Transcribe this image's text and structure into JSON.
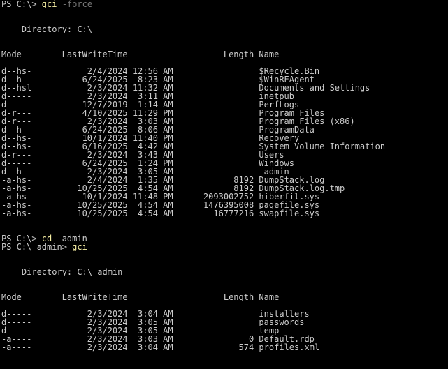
{
  "session1": {
    "prompt": "PS C:\\> ",
    "command": "gci",
    "param": " -force",
    "directory_label": "    Directory: C:\\",
    "headers": {
      "mode": "Mode",
      "lastwrite": "LastWriteTime",
      "length": "Length",
      "name": "Name"
    },
    "underlines": {
      "mode": "----",
      "lastwrite": "-------------",
      "length": "------",
      "name": "----"
    },
    "rows": [
      {
        "mode": "d--hs-",
        "date": "2/4/2024",
        "time": "12:56 AM",
        "length": "",
        "name": "$Recycle.Bin"
      },
      {
        "mode": "d--h--",
        "date": "6/24/2025",
        "time": "8:23 AM",
        "length": "",
        "name": "$WinREAgent"
      },
      {
        "mode": "d--hsl",
        "date": "2/3/2024",
        "time": "11:32 AM",
        "length": "",
        "name": "Documents and Settings"
      },
      {
        "mode": "d-----",
        "date": "2/3/2024",
        "time": "3:11 AM",
        "length": "",
        "name": "inetpub"
      },
      {
        "mode": "d-----",
        "date": "12/7/2019",
        "time": "1:14 AM",
        "length": "",
        "name": "PerfLogs"
      },
      {
        "mode": "d-r---",
        "date": "4/10/2025",
        "time": "11:29 PM",
        "length": "",
        "name": "Program Files"
      },
      {
        "mode": "d-r---",
        "date": "2/3/2024",
        "time": "3:03 AM",
        "length": "",
        "name": "Program Files (x86)"
      },
      {
        "mode": "d--h--",
        "date": "6/24/2025",
        "time": "8:06 AM",
        "length": "",
        "name": "ProgramData"
      },
      {
        "mode": "d--hs-",
        "date": "10/1/2024",
        "time": "11:40 PM",
        "length": "",
        "name": "Recovery"
      },
      {
        "mode": "d--hs-",
        "date": "6/16/2025",
        "time": "4:42 AM",
        "length": "",
        "name": "System Volume Information"
      },
      {
        "mode": "d-r---",
        "date": "2/3/2024",
        "time": "3:43 AM",
        "length": "",
        "name": "Users"
      },
      {
        "mode": "d-----",
        "date": "6/24/2025",
        "time": "1:24 PM",
        "length": "",
        "name": "Windows"
      },
      {
        "mode": "d--h--",
        "date": "2/3/2024",
        "time": "3:05 AM",
        "length": "",
        "name": "_admin"
      },
      {
        "mode": "-a-hs-",
        "date": "2/4/2024",
        "time": "1:35 AM",
        "length": "8192",
        "name": "DumpStack.log"
      },
      {
        "mode": "-a-hs-",
        "date": "10/25/2025",
        "time": "4:54 AM",
        "length": "8192",
        "name": "DumpStack.log.tmp"
      },
      {
        "mode": "-a-hs-",
        "date": "10/1/2024",
        "time": "11:48 PM",
        "length": "2093002752",
        "name": "hiberfil.sys"
      },
      {
        "mode": "-a-hs-",
        "date": "10/25/2025",
        "time": "4:54 AM",
        "length": "1476395008",
        "name": "pagefile.sys"
      },
      {
        "mode": "-a-hs-",
        "date": "10/25/2025",
        "time": "4:54 AM",
        "length": "16777216",
        "name": "swapfile.sys"
      }
    ]
  },
  "cd_command": {
    "prompt": "PS C:\\> ",
    "command": "cd",
    "arg": " _admin"
  },
  "session2": {
    "prompt": "PS C:\\_admin> ",
    "command": "gci",
    "directory_label": "    Directory: C:\\_admin",
    "headers": {
      "mode": "Mode",
      "lastwrite": "LastWriteTime",
      "length": "Length",
      "name": "Name"
    },
    "underlines": {
      "mode": "----",
      "lastwrite": "-------------",
      "length": "------",
      "name": "----"
    },
    "rows": [
      {
        "mode": "d-----",
        "date": "2/3/2024",
        "time": "3:04 AM",
        "length": "",
        "name": "installers"
      },
      {
        "mode": "d-----",
        "date": "2/3/2024",
        "time": "3:05 AM",
        "length": "",
        "name": "passwords"
      },
      {
        "mode": "d-----",
        "date": "2/3/2024",
        "time": "3:05 AM",
        "length": "",
        "name": "temp"
      },
      {
        "mode": "-a----",
        "date": "2/3/2024",
        "time": "3:03 AM",
        "length": "0",
        "name": "Default.rdp"
      },
      {
        "mode": "-a----",
        "date": "2/3/2024",
        "time": "3:04 AM",
        "length": "574",
        "name": "profiles.xml"
      }
    ]
  },
  "colors": {
    "background": "#000000",
    "text": "#cccccc",
    "command": "#f9f1a5",
    "parameter": "#767676"
  }
}
